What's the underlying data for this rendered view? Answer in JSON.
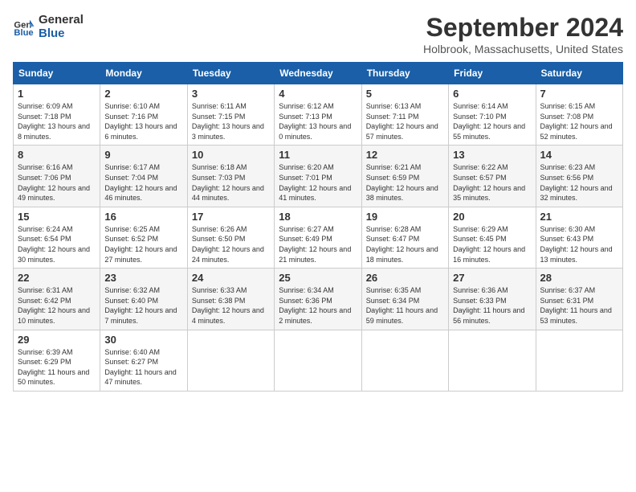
{
  "app": {
    "logo_line1": "General",
    "logo_line2": "Blue"
  },
  "header": {
    "month": "September 2024",
    "location": "Holbrook, Massachusetts, United States"
  },
  "days_of_week": [
    "Sunday",
    "Monday",
    "Tuesday",
    "Wednesday",
    "Thursday",
    "Friday",
    "Saturday"
  ],
  "weeks": [
    [
      {
        "day": "1",
        "rise": "6:09 AM",
        "set": "7:18 PM",
        "daylight": "13 hours and 8 minutes."
      },
      {
        "day": "2",
        "rise": "6:10 AM",
        "set": "7:16 PM",
        "daylight": "13 hours and 6 minutes."
      },
      {
        "day": "3",
        "rise": "6:11 AM",
        "set": "7:15 PM",
        "daylight": "13 hours and 3 minutes."
      },
      {
        "day": "4",
        "rise": "6:12 AM",
        "set": "7:13 PM",
        "daylight": "13 hours and 0 minutes."
      },
      {
        "day": "5",
        "rise": "6:13 AM",
        "set": "7:11 PM",
        "daylight": "12 hours and 57 minutes."
      },
      {
        "day": "6",
        "rise": "6:14 AM",
        "set": "7:10 PM",
        "daylight": "12 hours and 55 minutes."
      },
      {
        "day": "7",
        "rise": "6:15 AM",
        "set": "7:08 PM",
        "daylight": "12 hours and 52 minutes."
      }
    ],
    [
      {
        "day": "8",
        "rise": "6:16 AM",
        "set": "7:06 PM",
        "daylight": "12 hours and 49 minutes."
      },
      {
        "day": "9",
        "rise": "6:17 AM",
        "set": "7:04 PM",
        "daylight": "12 hours and 46 minutes."
      },
      {
        "day": "10",
        "rise": "6:18 AM",
        "set": "7:03 PM",
        "daylight": "12 hours and 44 minutes."
      },
      {
        "day": "11",
        "rise": "6:20 AM",
        "set": "7:01 PM",
        "daylight": "12 hours and 41 minutes."
      },
      {
        "day": "12",
        "rise": "6:21 AM",
        "set": "6:59 PM",
        "daylight": "12 hours and 38 minutes."
      },
      {
        "day": "13",
        "rise": "6:22 AM",
        "set": "6:57 PM",
        "daylight": "12 hours and 35 minutes."
      },
      {
        "day": "14",
        "rise": "6:23 AM",
        "set": "6:56 PM",
        "daylight": "12 hours and 32 minutes."
      }
    ],
    [
      {
        "day": "15",
        "rise": "6:24 AM",
        "set": "6:54 PM",
        "daylight": "12 hours and 30 minutes."
      },
      {
        "day": "16",
        "rise": "6:25 AM",
        "set": "6:52 PM",
        "daylight": "12 hours and 27 minutes."
      },
      {
        "day": "17",
        "rise": "6:26 AM",
        "set": "6:50 PM",
        "daylight": "12 hours and 24 minutes."
      },
      {
        "day": "18",
        "rise": "6:27 AM",
        "set": "6:49 PM",
        "daylight": "12 hours and 21 minutes."
      },
      {
        "day": "19",
        "rise": "6:28 AM",
        "set": "6:47 PM",
        "daylight": "12 hours and 18 minutes."
      },
      {
        "day": "20",
        "rise": "6:29 AM",
        "set": "6:45 PM",
        "daylight": "12 hours and 16 minutes."
      },
      {
        "day": "21",
        "rise": "6:30 AM",
        "set": "6:43 PM",
        "daylight": "12 hours and 13 minutes."
      }
    ],
    [
      {
        "day": "22",
        "rise": "6:31 AM",
        "set": "6:42 PM",
        "daylight": "12 hours and 10 minutes."
      },
      {
        "day": "23",
        "rise": "6:32 AM",
        "set": "6:40 PM",
        "daylight": "12 hours and 7 minutes."
      },
      {
        "day": "24",
        "rise": "6:33 AM",
        "set": "6:38 PM",
        "daylight": "12 hours and 4 minutes."
      },
      {
        "day": "25",
        "rise": "6:34 AM",
        "set": "6:36 PM",
        "daylight": "12 hours and 2 minutes."
      },
      {
        "day": "26",
        "rise": "6:35 AM",
        "set": "6:34 PM",
        "daylight": "11 hours and 59 minutes."
      },
      {
        "day": "27",
        "rise": "6:36 AM",
        "set": "6:33 PM",
        "daylight": "11 hours and 56 minutes."
      },
      {
        "day": "28",
        "rise": "6:37 AM",
        "set": "6:31 PM",
        "daylight": "11 hours and 53 minutes."
      }
    ],
    [
      {
        "day": "29",
        "rise": "6:39 AM",
        "set": "6:29 PM",
        "daylight": "11 hours and 50 minutes."
      },
      {
        "day": "30",
        "rise": "6:40 AM",
        "set": "6:27 PM",
        "daylight": "11 hours and 47 minutes."
      },
      null,
      null,
      null,
      null,
      null
    ]
  ],
  "labels": {
    "sunrise": "Sunrise:",
    "sunset": "Sunset:",
    "daylight": "Daylight:"
  }
}
